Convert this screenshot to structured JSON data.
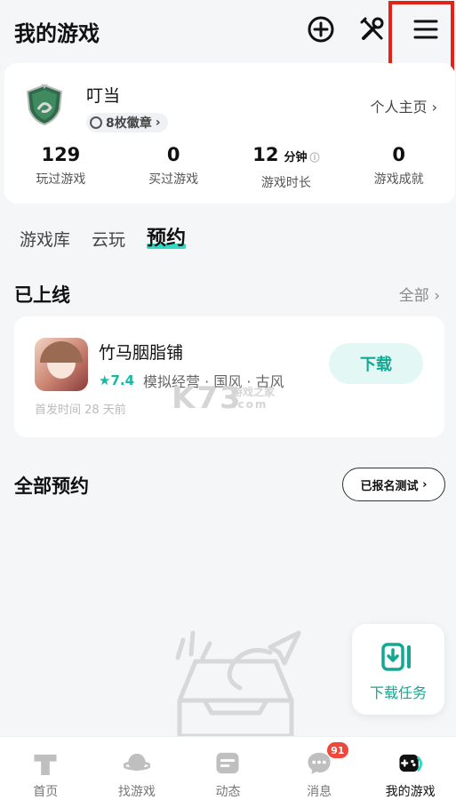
{
  "header": {
    "title": "我的游戏",
    "icons": [
      "add-circle-icon",
      "tools-icon",
      "menu-icon"
    ]
  },
  "profile": {
    "username": "叮当",
    "badge_label": "8枚徽章",
    "home_link": "个人主页",
    "stats": [
      {
        "value": "129",
        "unit": "",
        "label": "玩过游戏"
      },
      {
        "value": "0",
        "unit": "",
        "label": "买过游戏"
      },
      {
        "value": "12",
        "unit": "分钟",
        "label": "游戏时长"
      },
      {
        "value": "0",
        "unit": "",
        "label": "游戏成就"
      }
    ]
  },
  "tabs": [
    {
      "label": "游戏库",
      "active": false
    },
    {
      "label": "云玩",
      "active": false
    },
    {
      "label": "预约",
      "active": true
    }
  ],
  "online_section": {
    "title": "已上线",
    "more": "全部",
    "game": {
      "name": "竹马胭脂铺",
      "score": "7.4",
      "tags": "模拟经营 · 国风 · 古风",
      "date": "首发时间 28 天前",
      "action": "下载"
    }
  },
  "watermark": {
    "main": "K73",
    "sub": "游戏之家",
    "domain": ".com"
  },
  "reserve_section": {
    "title": "全部预约",
    "button": "已报名测试"
  },
  "download_task": {
    "label": "下载任务"
  },
  "bottom_nav": [
    {
      "label": "首页",
      "icon": "home-icon",
      "active": false
    },
    {
      "label": "找游戏",
      "icon": "planet-icon",
      "active": false
    },
    {
      "label": "动态",
      "icon": "feed-icon",
      "active": false
    },
    {
      "label": "消息",
      "icon": "message-icon",
      "active": false,
      "badge": "91"
    },
    {
      "label": "我的游戏",
      "icon": "gamepad-icon",
      "active": true
    }
  ],
  "colors": {
    "accent": "#13a892",
    "highlight": "#2fd9c4",
    "alert": "#e2231a"
  }
}
